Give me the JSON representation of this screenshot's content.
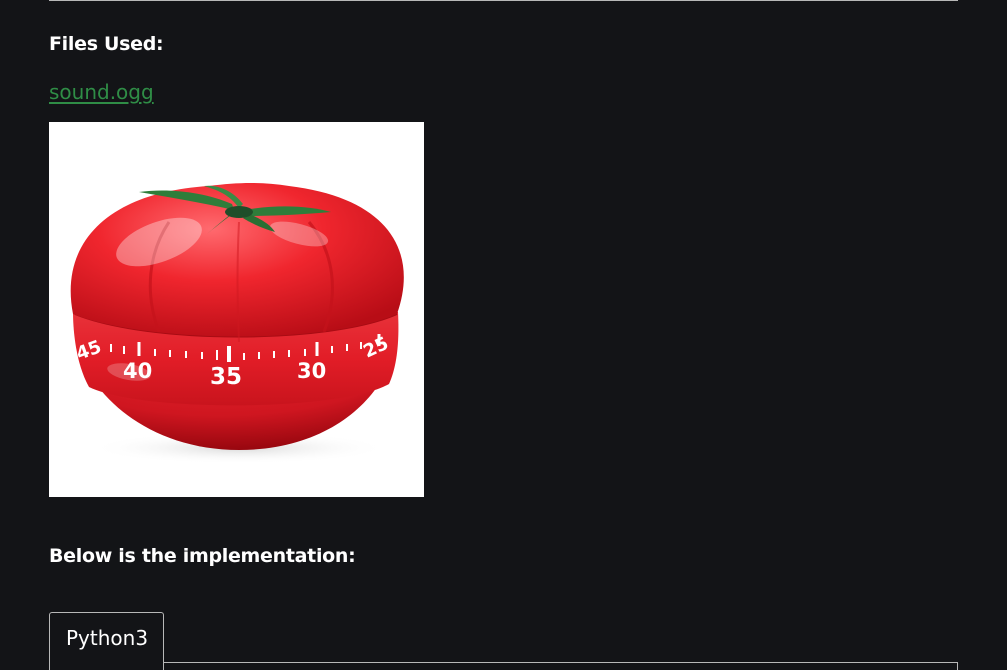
{
  "files_section": {
    "heading": "Files Used:",
    "file_link": "sound.ogg"
  },
  "image": {
    "subject": "tomato-kitchen-timer",
    "dial_numbers": [
      "45",
      "40",
      "35",
      "30",
      "25"
    ]
  },
  "implementation": {
    "heading": "Below is the implementation:"
  },
  "code_tabs": {
    "active_tab": "Python3"
  },
  "colors": {
    "background": "#131417",
    "link": "#2f8d46",
    "text": "#ffffff",
    "border": "#b8b8b8"
  }
}
